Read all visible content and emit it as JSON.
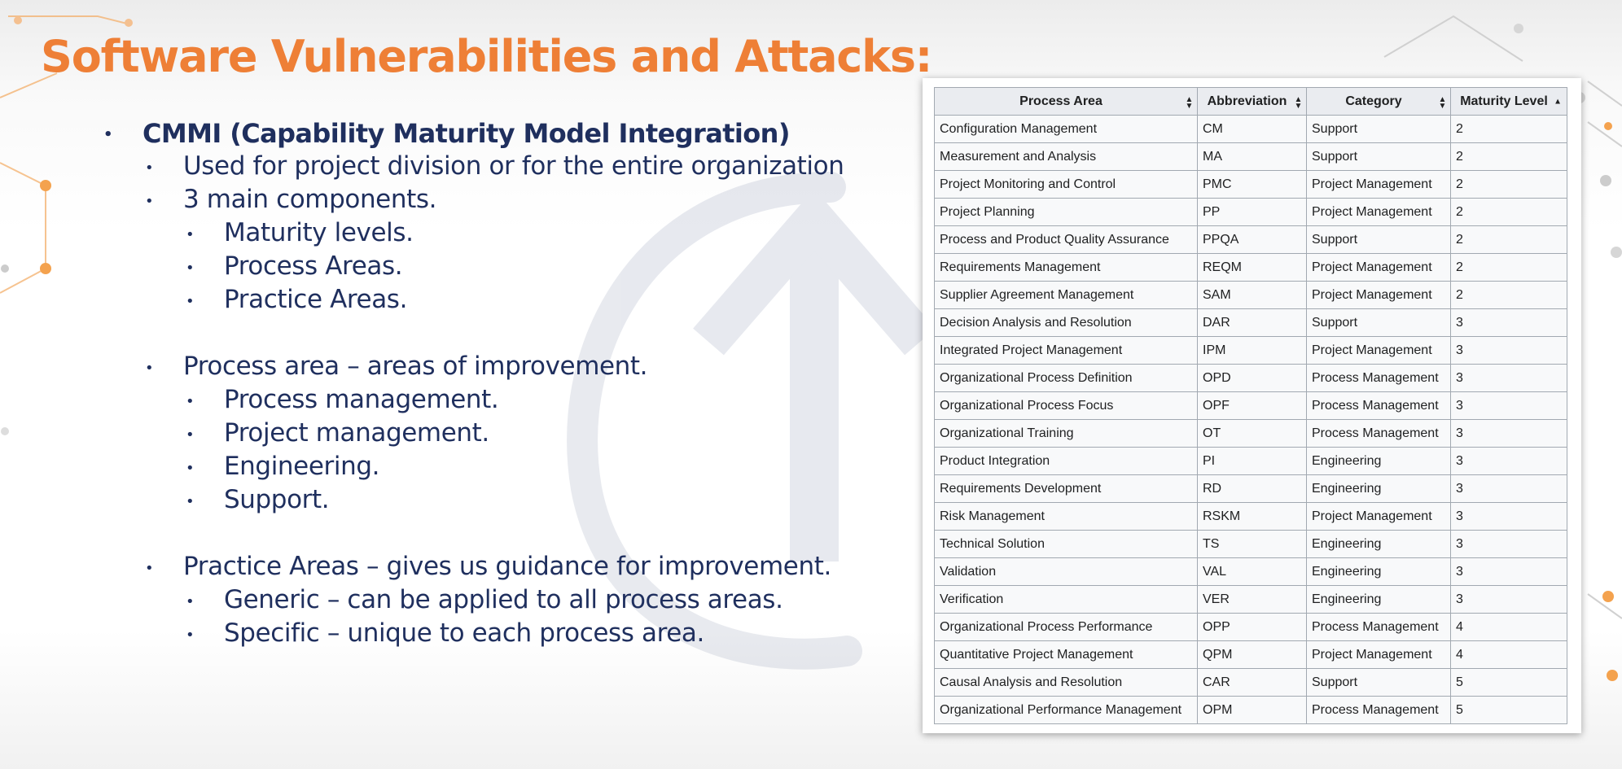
{
  "slide": {
    "title": "Software Vulnerabilities and Attacks:",
    "bullets": {
      "cmmi": "CMMI (Capability Maturity Model Integration)",
      "used_for": "Used for project division or for the entire organization",
      "components": "3 main components.",
      "maturity_levels": "Maturity levels.",
      "process_areas": "Process Areas.",
      "practice_areas": "Practice Areas.",
      "process_area_def": "Process area – areas of improvement.",
      "process_mgmt": "Process management.",
      "project_mgmt": "Project management.",
      "engineering": "Engineering.",
      "support": "Support.",
      "practice_areas_def": "Practice Areas – gives us guidance for improvement.",
      "generic": "Generic – can be applied to all process areas.",
      "specific": "Specific – unique to each process area."
    },
    "bullet_glyph": "•"
  },
  "table": {
    "columns": [
      "Process Area",
      "Abbreviation",
      "Category",
      "Maturity Level"
    ],
    "sort_icons": [
      "▲▼",
      "▲▼",
      "▲▼",
      "▲"
    ],
    "rows": [
      [
        "Configuration Management",
        "CM",
        "Support",
        "2"
      ],
      [
        "Measurement and Analysis",
        "MA",
        "Support",
        "2"
      ],
      [
        "Project Monitoring and Control",
        "PMC",
        "Project Management",
        "2"
      ],
      [
        "Project Planning",
        "PP",
        "Project Management",
        "2"
      ],
      [
        "Process and Product Quality Assurance",
        "PPQA",
        "Support",
        "2"
      ],
      [
        "Requirements Management",
        "REQM",
        "Project Management",
        "2"
      ],
      [
        "Supplier Agreement Management",
        "SAM",
        "Project Management",
        "2"
      ],
      [
        "Decision Analysis and Resolution",
        "DAR",
        "Support",
        "3"
      ],
      [
        "Integrated Project Management",
        "IPM",
        "Project Management",
        "3"
      ],
      [
        "Organizational Process Definition",
        "OPD",
        "Process Management",
        "3"
      ],
      [
        "Organizational Process Focus",
        "OPF",
        "Process Management",
        "3"
      ],
      [
        "Organizational Training",
        "OT",
        "Process Management",
        "3"
      ],
      [
        "Product Integration",
        "PI",
        "Engineering",
        "3"
      ],
      [
        "Requirements Development",
        "RD",
        "Engineering",
        "3"
      ],
      [
        "Risk Management",
        "RSKM",
        "Project Management",
        "3"
      ],
      [
        "Technical Solution",
        "TS",
        "Engineering",
        "3"
      ],
      [
        "Validation",
        "VAL",
        "Engineering",
        "3"
      ],
      [
        "Verification",
        "VER",
        "Engineering",
        "3"
      ],
      [
        "Organizational Process Performance",
        "OPP",
        "Process Management",
        "4"
      ],
      [
        "Quantitative Project Management",
        "QPM",
        "Project Management",
        "4"
      ],
      [
        "Causal Analysis and Resolution",
        "CAR",
        "Support",
        "5"
      ],
      [
        "Organizational Performance Management",
        "OPM",
        "Process Management",
        "5"
      ]
    ]
  },
  "colors": {
    "title": "#ee7f36",
    "body_text": "#1f2f5e",
    "table_header_bg": "#eaecf0",
    "table_cell_bg": "#f8f9fa",
    "table_border": "#a2a9b1",
    "decor_orange": "#f4a24e",
    "decor_gray": "#c8c8c8",
    "watermark": "#9aa6bf"
  }
}
